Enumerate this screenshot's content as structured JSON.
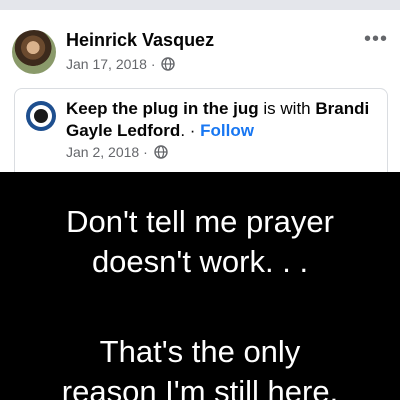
{
  "post": {
    "author": "Heinrick Vasquez",
    "date": "Jan 17, 2018",
    "dot": "·",
    "more": "•••"
  },
  "shared": {
    "page_name": "Keep the plug in the jug",
    "is_with": " is with ",
    "tagged_name": "Brandi Gayle Ledford",
    "period": ".",
    "separator": " · ",
    "follow_label": "Follow",
    "date": "Jan 2, 2018",
    "dot": "·"
  },
  "image_text": {
    "line1": "Don't tell me prayer",
    "line2": "doesn't work. . .",
    "line3": "That's the only",
    "line4": "reason I'm still here."
  },
  "icons": {
    "privacy": "globe-icon",
    "menu": "more-options-icon"
  }
}
